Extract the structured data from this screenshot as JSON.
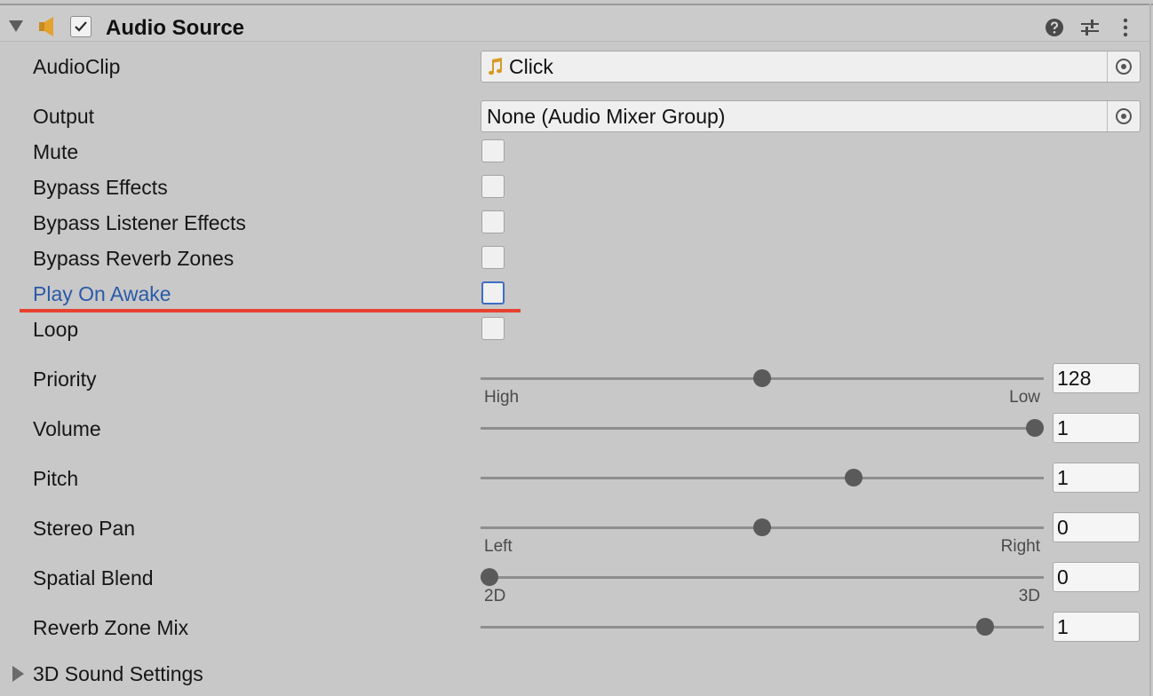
{
  "component": {
    "title": "Audio Source",
    "enabled": true,
    "icons": [
      "speaker-icon",
      "help-icon",
      "presets-icon",
      "kebab-menu-icon"
    ]
  },
  "fields": {
    "audioclip": {
      "label": "AudioClip",
      "value": "Click",
      "icon": "music-note-icon"
    },
    "output": {
      "label": "Output",
      "value": "None (Audio Mixer Group)"
    },
    "mute": {
      "label": "Mute",
      "checked": false
    },
    "bypass_effects": {
      "label": "Bypass Effects",
      "checked": false
    },
    "bypass_listener_effects": {
      "label": "Bypass Listener Effects",
      "checked": false
    },
    "bypass_reverb_zones": {
      "label": "Bypass Reverb Zones",
      "checked": false
    },
    "play_on_awake": {
      "label": "Play On Awake",
      "checked": false,
      "highlighted": true
    },
    "loop": {
      "label": "Loop",
      "checked": false
    },
    "priority": {
      "label": "Priority",
      "value": "128",
      "min_label": "High",
      "max_label": "Low",
      "level": 0.5
    },
    "volume": {
      "label": "Volume",
      "value": "1",
      "level": 1.0
    },
    "pitch": {
      "label": "Pitch",
      "value": "1",
      "level": 0.667
    },
    "stereo_pan": {
      "label": "Stereo Pan",
      "value": "0",
      "min_label": "Left",
      "max_label": "Right",
      "level": 0.5
    },
    "spatial_blend": {
      "label": "Spatial Blend",
      "value": "0",
      "min_label": "2D",
      "max_label": "3D",
      "level": 0.0
    },
    "reverb_zone_mix": {
      "label": "Reverb Zone Mix",
      "value": "1",
      "level": 0.909
    }
  },
  "foldout": {
    "label": "3D Sound Settings",
    "expanded": false
  },
  "colors": {
    "background": "#c8c8c8",
    "highlight_label": "#2a5aa8",
    "annotation_underline": "#e8412f",
    "speaker_icon": "#e3a32f"
  }
}
